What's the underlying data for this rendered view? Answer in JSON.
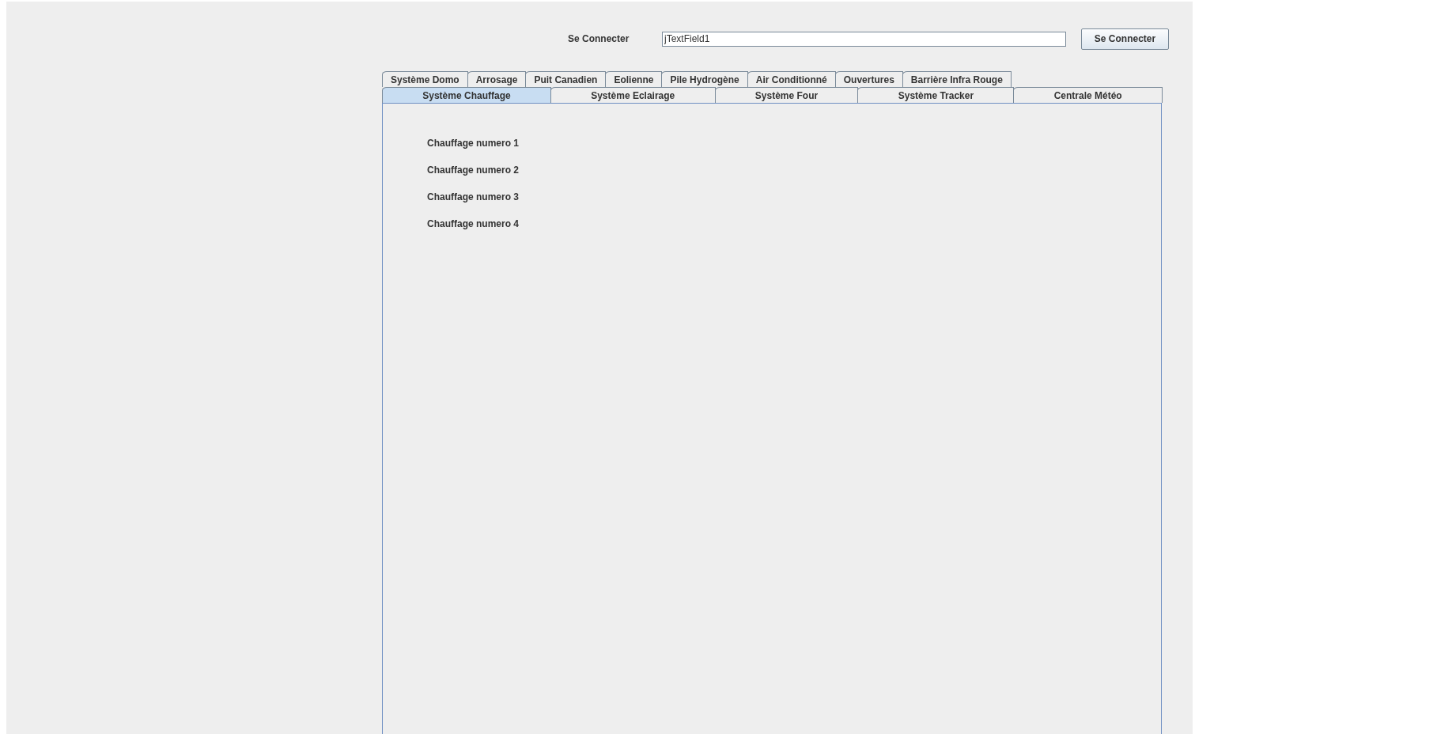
{
  "connect": {
    "label": "Se Connecter",
    "field_value": "jTextField1",
    "button": "Se Connecter"
  },
  "tab_rows": [
    {
      "tabs": [
        {
          "label": "Système Domo",
          "selected": false
        },
        {
          "label": "Arrosage",
          "selected": false
        },
        {
          "label": "Puit Canadien",
          "selected": false
        },
        {
          "label": "Eolienne",
          "selected": false
        },
        {
          "label": "Pile Hydrogène",
          "selected": false
        },
        {
          "label": "Air Conditionné",
          "selected": false
        },
        {
          "label": "Ouvertures",
          "selected": false
        },
        {
          "label": "Barrière Infra Rouge",
          "selected": false
        }
      ]
    },
    {
      "tabs": [
        {
          "label": "Système Chauffage",
          "selected": true
        },
        {
          "label": "Système Eclairage",
          "selected": false
        },
        {
          "label": "Système Four",
          "selected": false
        },
        {
          "label": "Système Tracker",
          "selected": false
        },
        {
          "label": "Centrale Météo",
          "selected": false
        }
      ]
    }
  ],
  "heaters": [
    {
      "label": "Chauffage numero 1"
    },
    {
      "label": "Chauffage numero 2"
    },
    {
      "label": "Chauffage numero 3"
    },
    {
      "label": "Chauffage numero 4"
    }
  ]
}
